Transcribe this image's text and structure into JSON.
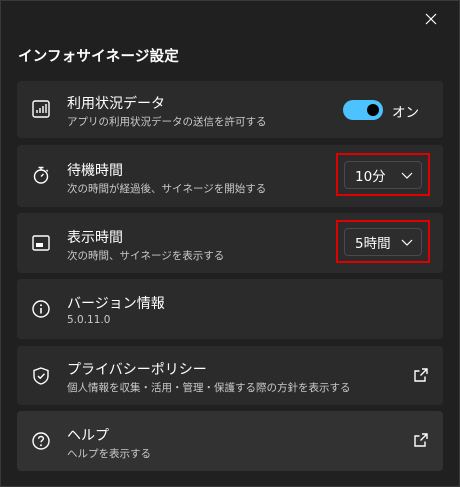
{
  "window": {
    "title": "インフォサイネージ設定"
  },
  "items": [
    {
      "label": "利用状況データ",
      "desc": "アプリの利用状況データの送信を許可する",
      "toggle_state": "オン",
      "icon": "chart-icon"
    },
    {
      "label": "待機時間",
      "desc": "次の時間が経過後、サイネージを開始する",
      "value": "10分",
      "icon": "stopwatch-icon"
    },
    {
      "label": "表示時間",
      "desc": "次の時間、サイネージを表示する",
      "value": "5時間",
      "icon": "screen-icon"
    },
    {
      "label": "バージョン情報",
      "desc": "5.0.11.0",
      "icon": "info-icon"
    },
    {
      "label": "プライバシーポリシー",
      "desc": "個人情報を収集・活用・管理・保護する際の方針を表示する",
      "icon": "shield-icon"
    },
    {
      "label": "ヘルプ",
      "desc": "ヘルプを表示する",
      "icon": "help-icon"
    }
  ],
  "colors": {
    "accent": "#4cc2ff",
    "highlight_box": "#e00000",
    "card": "#2b2b2b",
    "background": "#202020"
  }
}
